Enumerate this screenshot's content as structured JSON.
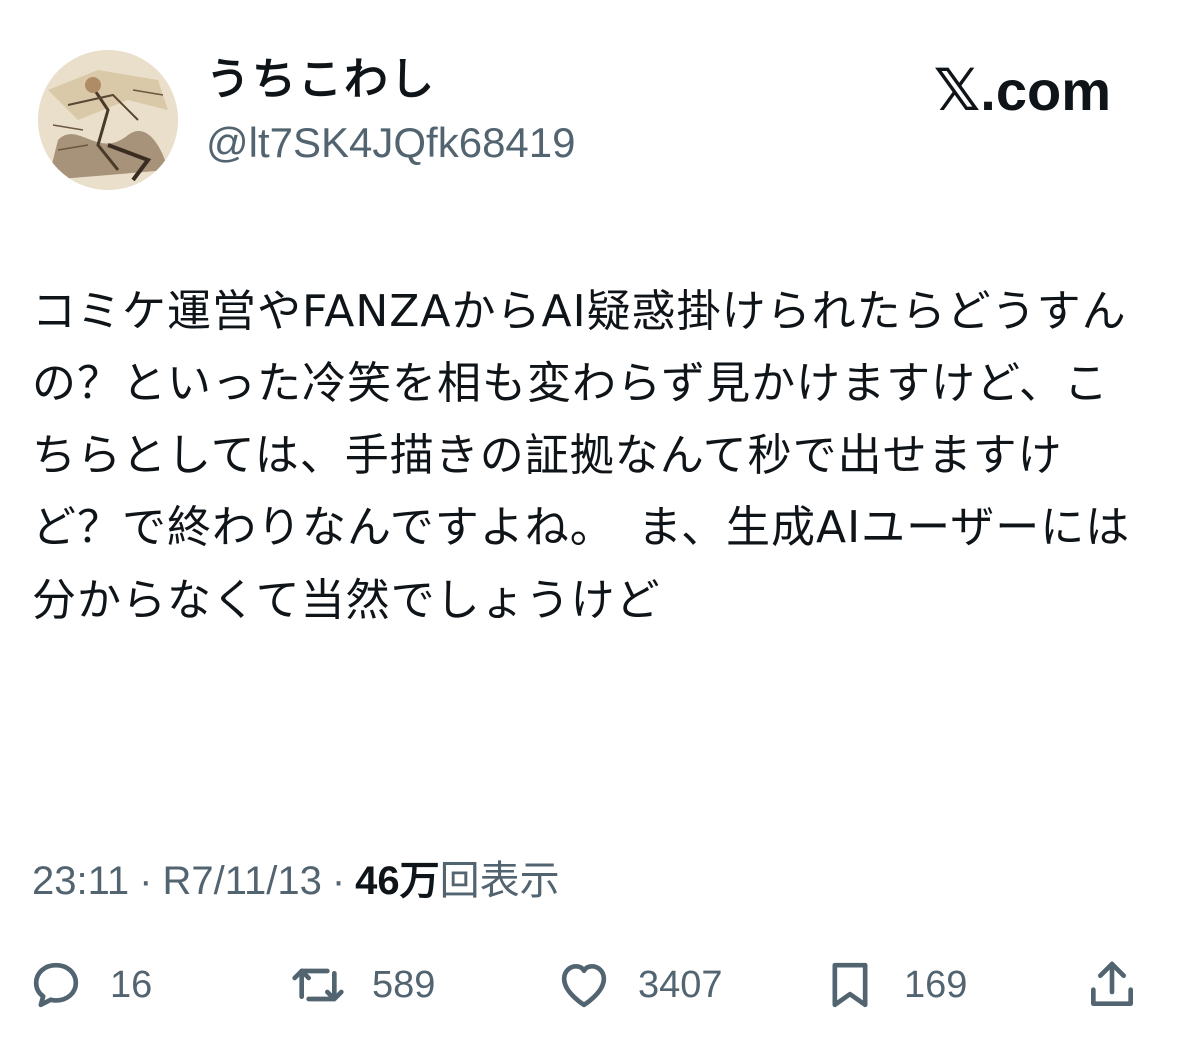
{
  "author": {
    "display_name": "うちこわし",
    "handle": "@lt7SK4JQfk68419",
    "avatar_icon": "avatar-sketch-icon"
  },
  "brand": {
    "x_glyph": "𝕏",
    "domain": ".com"
  },
  "tweet": {
    "text": "コミケ運営やFANZAからAI疑惑掛けられたらどうすんの？といった冷笑を相も変わらず見かけますけど、こちらとしては、手描きの証拠なんて秒で出せますけど？で終わりなんですよね。　ま、生成AIユーザーには分からなくて当然でしょうけど"
  },
  "meta": {
    "time": "23:11",
    "separator": "·",
    "date": "R7/11/13",
    "views_count": "46万",
    "views_label": "回表示"
  },
  "actions": {
    "reply": {
      "icon": "reply-icon",
      "count": "16"
    },
    "repost": {
      "icon": "repost-icon",
      "count": "589"
    },
    "like": {
      "icon": "heart-icon",
      "count": "3407"
    },
    "bookmark": {
      "icon": "bookmark-icon",
      "count": "169"
    },
    "share": {
      "icon": "share-icon"
    }
  },
  "colors": {
    "text_primary": "#0f1419",
    "text_secondary": "#536471",
    "background": "#ffffff"
  }
}
